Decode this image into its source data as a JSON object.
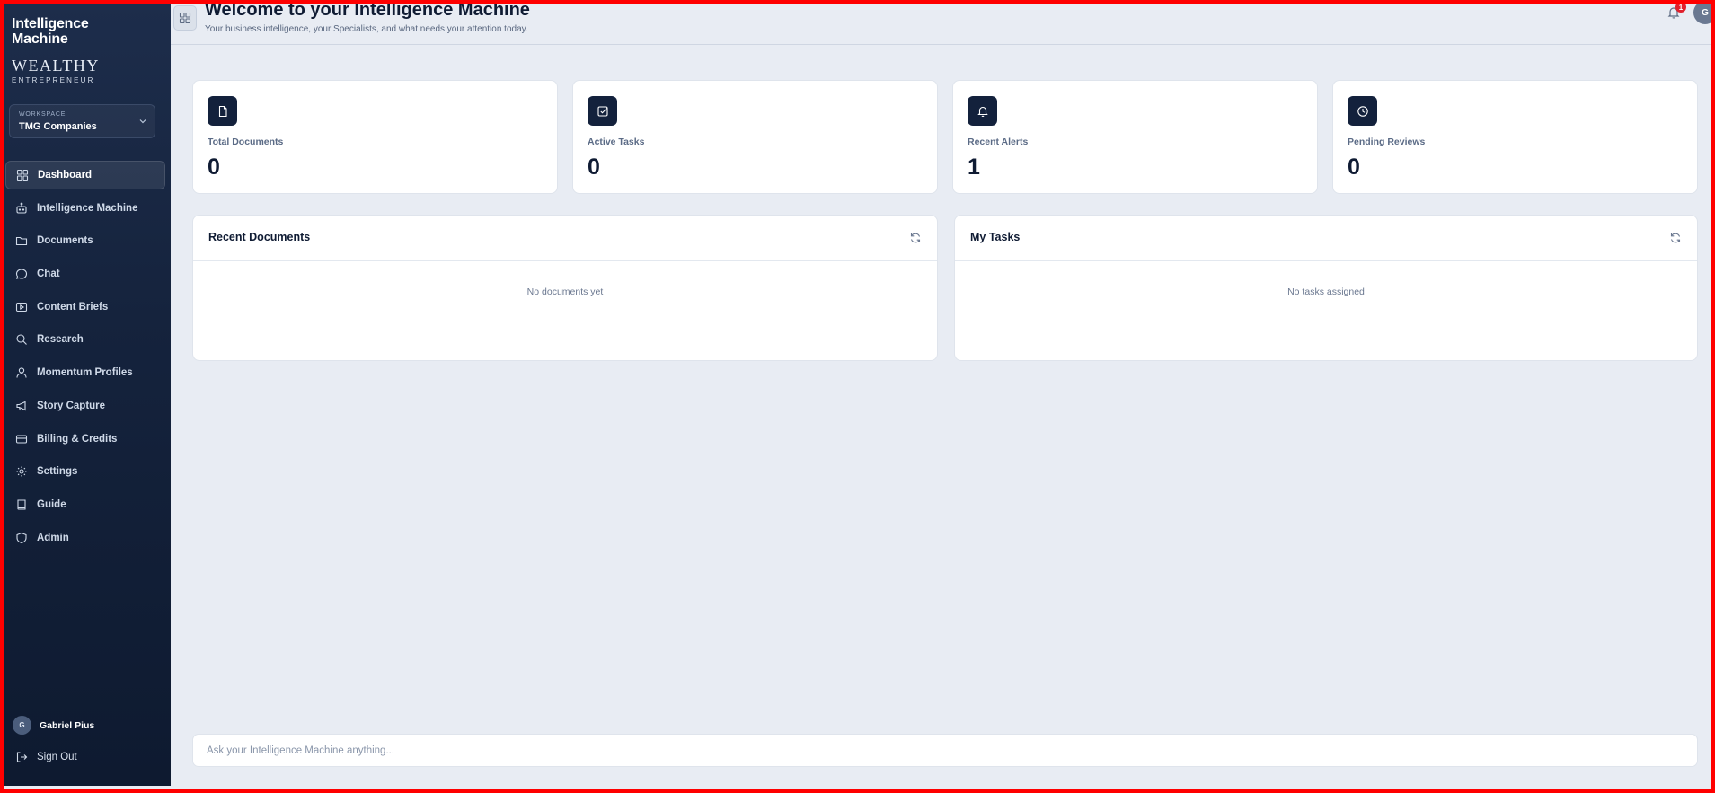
{
  "brand": {
    "title": "Intelligence Machine",
    "wordmark_line1": "WEALTHY",
    "wordmark_line2": "ENTREPRENEUR"
  },
  "workspace": {
    "label": "WORKSPACE",
    "value": "TMG Companies"
  },
  "sidebar": {
    "items": [
      {
        "label": "Dashboard",
        "icon": "dashboard-icon",
        "active": true
      },
      {
        "label": "Intelligence Machine",
        "icon": "robot-icon"
      },
      {
        "label": "Documents",
        "icon": "folder-icon"
      },
      {
        "label": "Chat",
        "icon": "chat-bubble-icon"
      },
      {
        "label": "Content Briefs",
        "icon": "video-icon"
      },
      {
        "label": "Research",
        "icon": "search-icon"
      },
      {
        "label": "Momentum Profiles",
        "icon": "user-icon"
      },
      {
        "label": "Story Capture",
        "icon": "megaphone-icon"
      },
      {
        "label": "Billing & Credits",
        "icon": "credit-card-icon"
      },
      {
        "label": "Settings",
        "icon": "gear-icon"
      },
      {
        "label": "Guide",
        "icon": "book-icon"
      },
      {
        "label": "Admin",
        "icon": "shield-icon"
      }
    ],
    "user": {
      "initial": "G",
      "name": "Gabriel Pius"
    },
    "signout_label": "Sign Out"
  },
  "header": {
    "title": "Welcome to your Intelligence Machine",
    "subtitle": "Your business intelligence, your Specialists, and what needs your attention today.",
    "notification_count": "1",
    "avatar_initial": "G"
  },
  "stats": [
    {
      "label": "Total Documents",
      "value": "0",
      "icon": "document-icon"
    },
    {
      "label": "Active Tasks",
      "value": "0",
      "icon": "checkbox-icon"
    },
    {
      "label": "Recent Alerts",
      "value": "1",
      "icon": "bell-icon"
    },
    {
      "label": "Pending Reviews",
      "value": "0",
      "icon": "clock-icon"
    }
  ],
  "panels": {
    "recent_documents": {
      "title": "Recent Documents",
      "empty": "No documents yet"
    },
    "my_tasks": {
      "title": "My Tasks",
      "empty": "No tasks assigned"
    }
  },
  "ask": {
    "placeholder": "Ask your Intelligence Machine anything..."
  },
  "colors": {
    "sidebar_bg": "#15233d",
    "accent": "#13213c",
    "page_bg": "#e8ecf3",
    "badge": "#e0202c"
  }
}
